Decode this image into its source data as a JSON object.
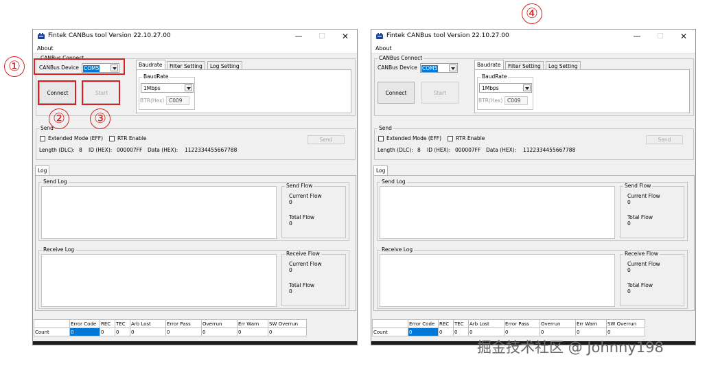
{
  "window": {
    "title": "Fintek CANBus tool Version 22.10.27.00",
    "menu_about": "About",
    "controls": {
      "minimize": "—",
      "maximize": "☐",
      "close": "✕"
    }
  },
  "connect_group": {
    "legend": "CANBus Connect",
    "device_label": "CANBus Device",
    "device_value": "COM5",
    "connect_button": "Connect",
    "start_button": "Start"
  },
  "settings_tabs": {
    "tabs": [
      "Baudrate",
      "Filter Setting",
      "Log Setting"
    ],
    "baudrate_legend": "BaudRate",
    "baudrate_value": "1Mbps",
    "btr_label": "BTR(Hex)",
    "btr_value": "C009"
  },
  "send_group": {
    "legend": "Send",
    "extended_mode": "Extended Mode (EFF)",
    "rtr_enable": "RTR Enable",
    "send_button": "Send",
    "length_label": "Length (DLC):",
    "length_value": "8",
    "id_label": "ID (HEX):",
    "id_value": "000007FF",
    "data_label": "Data (HEX):",
    "data_value": "1122334455667788"
  },
  "log_tab": {
    "label": "Log"
  },
  "send_log": {
    "legend": "Send Log",
    "flow_legend": "Send Flow",
    "current_label": "Current Flow",
    "current_value": "0",
    "total_label": "Total Flow",
    "total_value": "0"
  },
  "receive_log": {
    "legend": "Receive Log",
    "flow_legend": "Receive Flow",
    "current_label": "Current Flow",
    "current_value": "0",
    "total_label": "Total Flow",
    "total_value": "0"
  },
  "status_table": {
    "headers": [
      "Error Code",
      "REC",
      "TEC",
      "Arb Lost",
      "Error Pass",
      "Overrun",
      "Err Warn",
      "SW Overrun"
    ],
    "row_label": "Count",
    "values": [
      "0",
      "0",
      "0",
      "0",
      "0",
      "0",
      "0",
      "0"
    ]
  },
  "annotations": {
    "step1": "①",
    "step2": "②",
    "step3": "③",
    "step4": "④"
  },
  "watermark": "掘金技术社区 @ Johnny198",
  "colors": {
    "highlight": "#d42222",
    "selection": "#0078d7"
  }
}
